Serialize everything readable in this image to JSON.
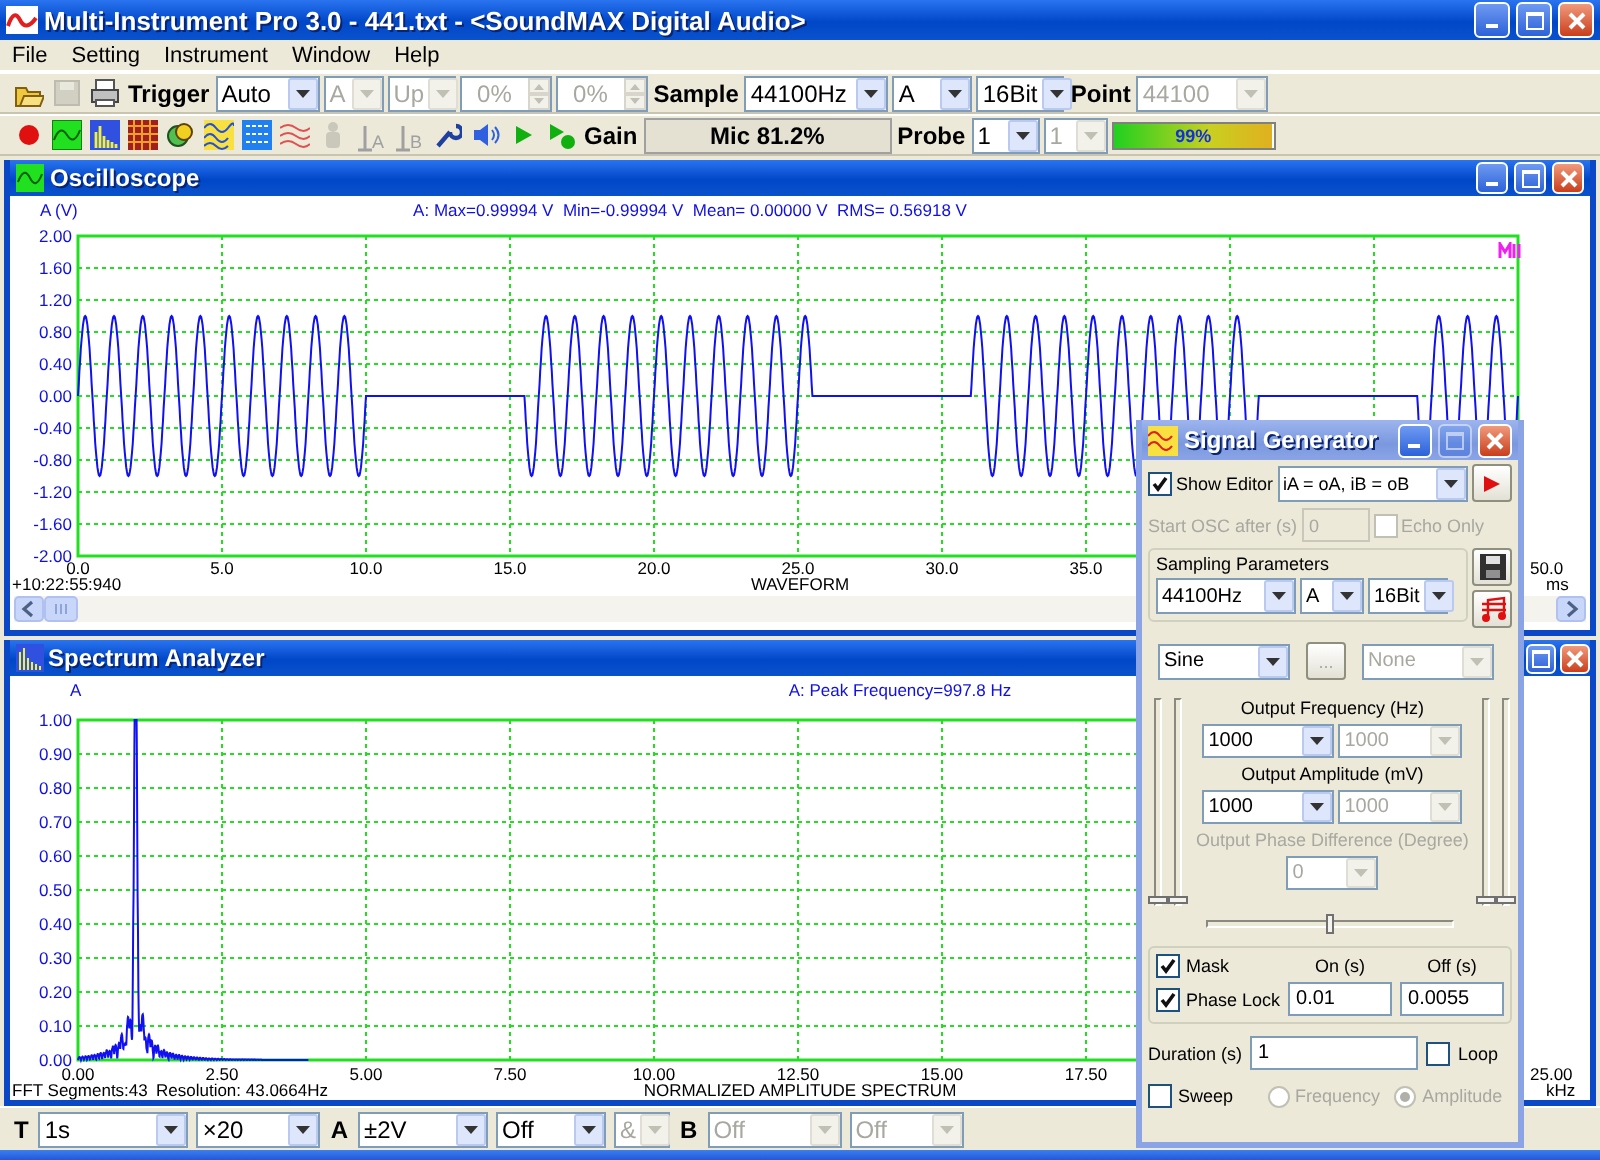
{
  "window": {
    "title": "Multi-Instrument Pro 3.0 - 441.txt - <SoundMAX Digital Audio>"
  },
  "menu": [
    "File",
    "Setting",
    "Instrument",
    "Window",
    "Help"
  ],
  "toolbar_rows": [
    [
      {
        "kind": "open",
        "disabled": false
      },
      {
        "kind": "save",
        "disabled": true
      },
      {
        "kind": "print",
        "disabled": false
      },
      {
        "kind": "label",
        "text": "Trigger"
      },
      {
        "kind": "dropdown",
        "value": "Auto",
        "disabled": false
      },
      {
        "kind": "dropdown",
        "value": "A",
        "disabled": true
      },
      {
        "kind": "dropdown",
        "value": "Up",
        "disabled": true
      },
      {
        "kind": "spin",
        "value": "0%",
        "disabled": true
      },
      {
        "kind": "spin",
        "value": "0%",
        "disabled": true
      },
      {
        "kind": "label",
        "text": "Sample"
      },
      {
        "kind": "dropdown",
        "value": "44100Hz",
        "disabled": false
      },
      {
        "kind": "dropdown",
        "value": "A",
        "disabled": false
      },
      {
        "kind": "dropdown",
        "value": "16Bit",
        "disabled": false
      },
      {
        "kind": "label",
        "text": "Point"
      },
      {
        "kind": "dropdown",
        "value": "44100",
        "disabled": true
      }
    ],
    [
      {
        "kind": "record",
        "disabled": false
      },
      {
        "kind": "scope",
        "disabled": false
      },
      {
        "kind": "spectrum",
        "disabled": false
      },
      {
        "kind": "checker",
        "disabled": false
      },
      {
        "kind": "circles",
        "disabled": false
      },
      {
        "kind": "waves",
        "disabled": false
      },
      {
        "kind": "matrix",
        "disabled": false
      },
      {
        "kind": "lines",
        "disabled": false
      },
      {
        "kind": "figure",
        "disabled": true
      },
      {
        "kind": "cursor",
        "text": "A",
        "disabled": true
      },
      {
        "kind": "cursor",
        "text": "B",
        "disabled": true
      },
      {
        "kind": "wrench",
        "disabled": false
      },
      {
        "kind": "speaker",
        "disabled": false
      },
      {
        "kind": "play",
        "disabled": false
      },
      {
        "kind": "playrec",
        "disabled": false
      },
      {
        "kind": "label",
        "text": "Gain"
      },
      {
        "kind": "status",
        "text": "Mic 81.2%"
      },
      {
        "kind": "label",
        "text": "Probe"
      },
      {
        "kind": "dropdown",
        "value": "1",
        "disabled": false
      },
      {
        "kind": "dropdown",
        "value": "1",
        "disabled": true
      },
      {
        "kind": "meter",
        "text": "99%",
        "level": 0.99
      }
    ]
  ],
  "oscilloscope": {
    "title": "Oscilloscope",
    "y_label": "A (V)",
    "info": "A: Max=0.99994 V  Min=-0.99994 V  Mean= 0.00000 V  RMS= 0.56918 V",
    "y_ticks": [
      "2.00",
      "1.60",
      "1.20",
      "0.80",
      "0.40",
      "0.00",
      "-0.40",
      "-0.80",
      "-1.20",
      "-1.60",
      "-2.00"
    ],
    "x_ticks": [
      "0.0",
      "5.0",
      "10.0",
      "15.0",
      "20.0",
      "25.0",
      "30.0",
      "35.0",
      "50.0"
    ],
    "x_unit": "ms",
    "timestamp": "+10:22:55:940",
    "x_label": "WAVEFORM"
  },
  "spectrum_analyzer": {
    "title": "Spectrum Analyzer",
    "y_label": "A",
    "info": "A: Peak Frequency=997.8 Hz",
    "y_ticks": [
      "1.00",
      "0.90",
      "0.80",
      "0.70",
      "0.60",
      "0.50",
      "0.40",
      "0.30",
      "0.20",
      "0.10",
      "0.00"
    ],
    "x_ticks": [
      "0.00",
      "2.50",
      "5.00",
      "7.50",
      "10.00",
      "12.50",
      "15.00",
      "17.50",
      "25.00"
    ],
    "x_unit": "kHz",
    "segments": "FFT Segments:43",
    "resolution": "Resolution: 43.0664Hz",
    "x_label": "NORMALIZED AMPLITUDE SPECTRUM"
  },
  "signal_generator": {
    "title": "Signal Generator",
    "show_editor": {
      "label": "Show Editor",
      "checked": true
    },
    "routing": "iA = oA, iB = oB",
    "start_osc": {
      "label": "Start OSC after (s)",
      "value": "0",
      "disabled": true
    },
    "echo_only": {
      "label": "Echo Only",
      "checked": false,
      "disabled": true
    },
    "sampling": {
      "title": "Sampling Parameters",
      "rate": "44100Hz",
      "channel": "A",
      "bits": "16Bit"
    },
    "waveform": "Sine",
    "more_button": {
      "label": "...",
      "disabled": true
    },
    "second_waveform": {
      "value": "None",
      "disabled": true
    },
    "left_sliders": [
      {
        "level": 0
      },
      {
        "level": 0
      }
    ],
    "right_sliders": [
      {
        "level": 0
      },
      {
        "level": 0
      }
    ],
    "frequency": {
      "label": "Output Frequency (Hz)",
      "value": "1000",
      "value_b": "1000"
    },
    "amplitude": {
      "label": "Output Amplitude (mV)",
      "value": "1000",
      "value_b": "1000"
    },
    "phase": {
      "label": "Output Phase Difference (Degree)",
      "value": "0",
      "disabled": true
    },
    "balance_slider": {
      "level": 0.5
    },
    "mask": {
      "label": "Mask",
      "checked": true
    },
    "on_label": "On (s)",
    "off_label": "Off (s)",
    "phase_lock": {
      "label": "Phase Lock",
      "checked": true
    },
    "on_value": "0.01",
    "off_value": "0.0055",
    "duration": {
      "label": "Duration (s)",
      "value": "1"
    },
    "loop": {
      "label": "Loop",
      "checked": false
    },
    "sweep": {
      "label": "Sweep",
      "checked": false
    },
    "sweep_modes": [
      {
        "label": "Frequency",
        "selected": false,
        "disabled": true
      },
      {
        "label": "Amplitude",
        "selected": true,
        "disabled": true
      }
    ]
  },
  "bottom_bar": [
    {
      "kind": "label",
      "text": "T"
    },
    {
      "kind": "dropdown",
      "value": "1s",
      "disabled": false
    },
    {
      "kind": "dropdown",
      "value": "×20",
      "disabled": false
    },
    {
      "kind": "label",
      "text": "A"
    },
    {
      "kind": "dropdown",
      "value": "±2V",
      "disabled": false
    },
    {
      "kind": "dropdown",
      "value": "Off",
      "disabled": false
    },
    {
      "kind": "dropdown",
      "value": "&",
      "disabled": true
    },
    {
      "kind": "label",
      "text": "B"
    },
    {
      "kind": "dropdown",
      "value": "Off",
      "disabled": true
    },
    {
      "kind": "dropdown",
      "value": "Off",
      "disabled": true
    }
  ]
}
